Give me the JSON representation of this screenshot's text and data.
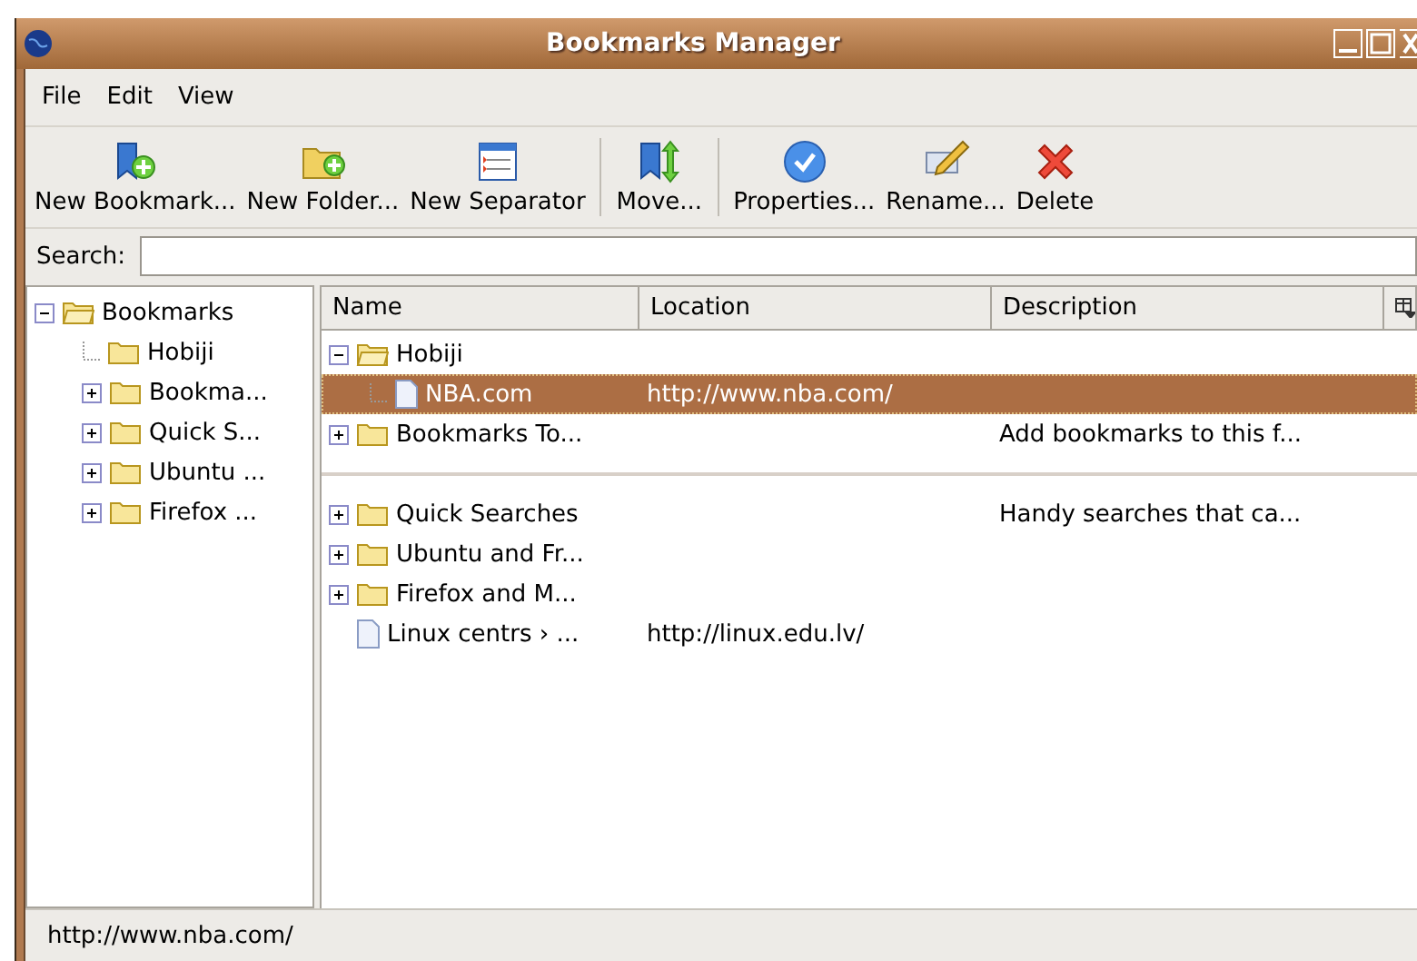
{
  "window": {
    "title": "Bookmarks Manager"
  },
  "menu": [
    "File",
    "Edit",
    "View"
  ],
  "toolbar": [
    {
      "kind": "new-bookmark",
      "label": "New Bookmark..."
    },
    {
      "kind": "new-folder",
      "label": "New Folder..."
    },
    {
      "kind": "new-separator",
      "label": "New Separator"
    },
    {
      "kind": "divider"
    },
    {
      "kind": "move",
      "label": "Move..."
    },
    {
      "kind": "divider"
    },
    {
      "kind": "properties",
      "label": "Properties..."
    },
    {
      "kind": "rename",
      "label": "Rename..."
    },
    {
      "kind": "delete",
      "label": "Delete"
    }
  ],
  "search": {
    "label": "Search:"
  },
  "sidebar": {
    "items": [
      {
        "label": "Bookmarks",
        "expanded": true,
        "children": [
          {
            "label": "Hobiji"
          },
          {
            "label": "Bookma...",
            "expanded": false
          },
          {
            "label": "Quick S...",
            "expanded": false
          },
          {
            "label": "Ubuntu ...",
            "expanded": false
          },
          {
            "label": "Firefox ...",
            "expanded": false
          }
        ]
      }
    ]
  },
  "table": {
    "columns": [
      "Name",
      "Location",
      "Description"
    ],
    "rows": [
      {
        "kind": "folder",
        "name": "Hobiji",
        "expanded": true,
        "selected": false,
        "children": [
          {
            "kind": "bookmark",
            "name": "NBA.com",
            "location": "http://www.nba.com/",
            "selected": true
          }
        ]
      },
      {
        "kind": "folder",
        "name": "Bookmarks To...",
        "description": "Add bookmarks to this f...",
        "expanded": false,
        "selected": false
      },
      {
        "kind": "separator",
        "selected": false
      },
      {
        "kind": "folder",
        "name": "Quick Searches",
        "description": "Handy searches that ca...",
        "expanded": false,
        "selected": false
      },
      {
        "kind": "folder",
        "name": "Ubuntu and Fr...",
        "expanded": false,
        "selected": false
      },
      {
        "kind": "folder",
        "name": "Firefox and M...",
        "expanded": false,
        "selected": false
      },
      {
        "kind": "bookmark",
        "name": "Linux centrs › ...",
        "location": "http://linux.edu.lv/",
        "selected": false
      }
    ]
  },
  "status_bar": "http://www.nba.com/"
}
